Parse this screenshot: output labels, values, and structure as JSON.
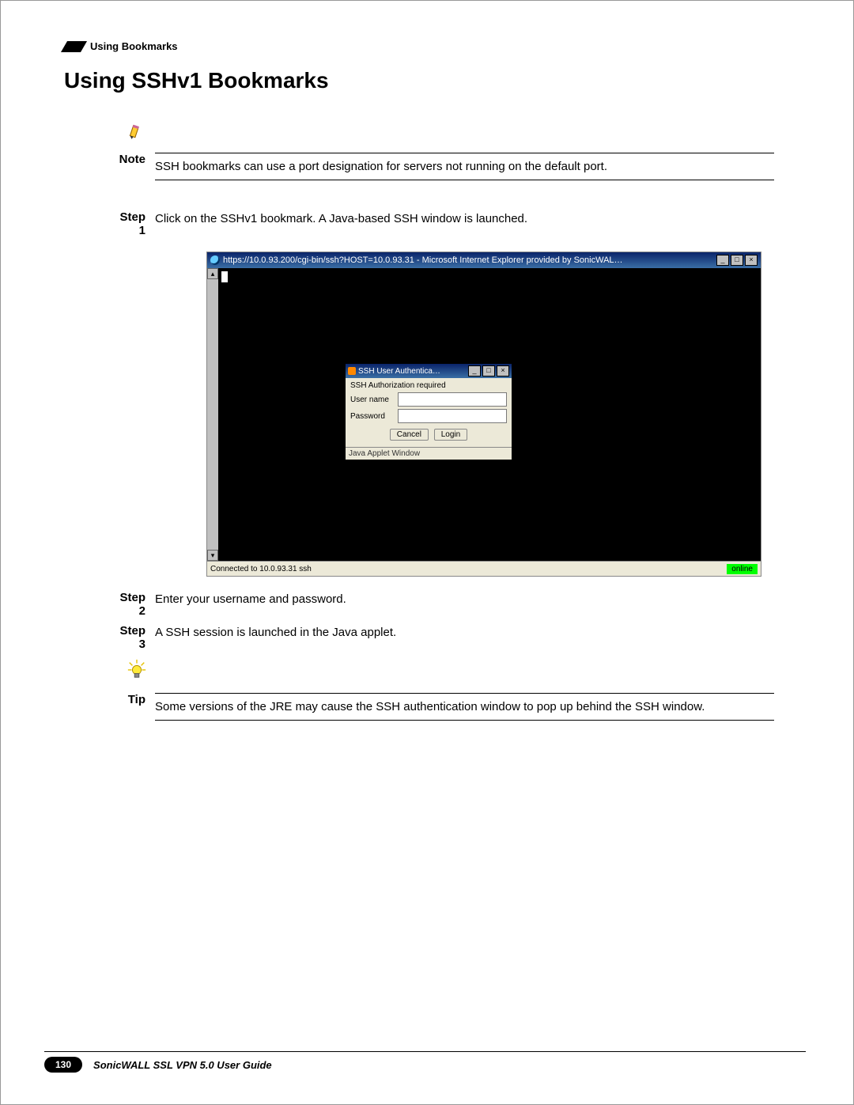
{
  "header": {
    "breadcrumb": "Using Bookmarks"
  },
  "title": "Using SSHv1 Bookmarks",
  "note": {
    "label": "Note",
    "text": "SSH bookmarks can use a port designation for servers not running on the default port."
  },
  "steps": [
    {
      "label": "Step 1",
      "text": "Click on the SSHv1 bookmark. A Java-based SSH window is launched."
    },
    {
      "label": "Step 2",
      "text": "Enter your username and password."
    },
    {
      "label": "Step 3",
      "text": "A SSH session is launched in the Java applet."
    }
  ],
  "tip": {
    "label": "Tip",
    "text": "Some versions of the JRE may cause the SSH authentication window to pop up behind the SSH window."
  },
  "screenshot": {
    "ie_title": "https://10.0.93.200/cgi-bin/ssh?HOST=10.0.93.31 - Microsoft Internet Explorer provided by SonicWAL…",
    "auth_title": "SSH User Authentica…",
    "auth_msg": "SSH Authorization required",
    "user_label": "User name",
    "pass_label": "Password",
    "cancel": "Cancel",
    "login": "Login",
    "applet_footer": "Java Applet Window",
    "status_left": "Connected to 10.0.93.31 ssh",
    "status_right": "online"
  },
  "footer": {
    "page": "130",
    "title": "SonicWALL SSL VPN 5.0 User Guide"
  }
}
